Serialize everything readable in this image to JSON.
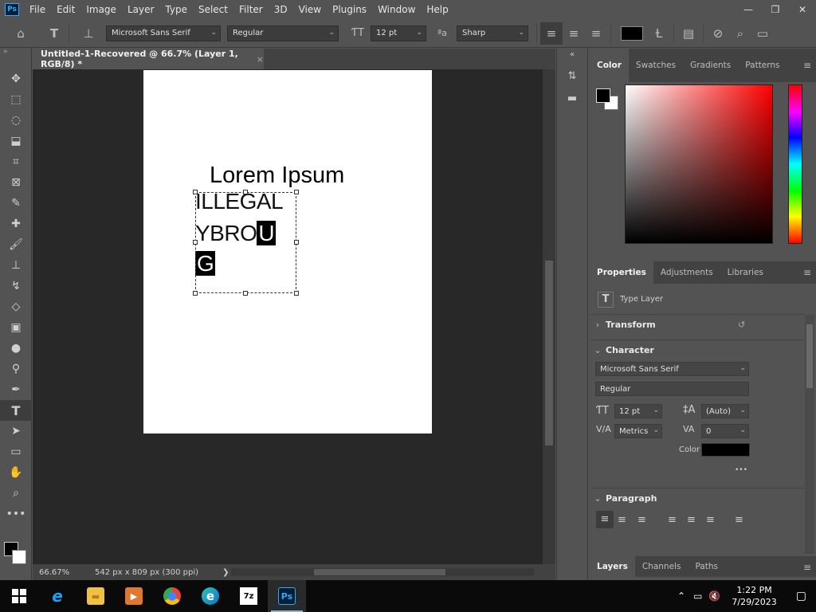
{
  "menu": {
    "logo": "Ps",
    "items": [
      "File",
      "Edit",
      "Image",
      "Layer",
      "Type",
      "Select",
      "Filter",
      "3D",
      "View",
      "Plugins",
      "Window",
      "Help"
    ]
  },
  "window_controls": {
    "minimize": "—",
    "restore": "❐",
    "close": "✕"
  },
  "options": {
    "font_family": "Microsoft Sans Serif",
    "font_style": "Regular",
    "font_size": "12 pt",
    "aa_label": "ªa",
    "antialias": "Sharp",
    "text_color": "#000000"
  },
  "document": {
    "tab_title": "Untitled-1-Recovered @ 66.7% (Layer 1, RGB/8) *",
    "tab_close": "×",
    "title_text": "Lorem Ipsum",
    "line1": "ILLEGAL",
    "line2_plain": "YBRO",
    "line2_selected": "U",
    "line3_selected": "G"
  },
  "status": {
    "zoom": "66.67%",
    "doc_info": "542 px x 809 px (300 ppi)",
    "arrow": "❯"
  },
  "color_panel": {
    "tabs": [
      "Color",
      "Swatches",
      "Gradients",
      "Patterns"
    ],
    "foreground": "#000000",
    "background": "#ffffff",
    "hue": "#ff0000"
  },
  "properties_panel": {
    "tabs": [
      "Properties",
      "Adjustments",
      "Libraries"
    ],
    "layer_type": "Type Layer",
    "transform_label": "Transform",
    "character_label": "Character",
    "font_family": "Microsoft Sans Serif",
    "font_style": "Regular",
    "font_size": "12 pt",
    "leading": "(Auto)",
    "kerning": "Metrics",
    "tracking": "0",
    "color_label": "Color",
    "color_value": "#000000",
    "more": "•••",
    "paragraph_label": "Paragraph"
  },
  "layers_panel": {
    "tabs": [
      "Layers",
      "Channels",
      "Paths"
    ]
  },
  "taskbar": {
    "apps": [
      {
        "name": "internet-explorer",
        "glyph": "e",
        "color": "#1ea1f1"
      },
      {
        "name": "file-explorer",
        "glyph": "▬",
        "color": "#f0c040"
      },
      {
        "name": "media-player",
        "glyph": "▶",
        "color": "#e07830"
      },
      {
        "name": "chrome",
        "glyph": "●",
        "color": "#4caf50"
      },
      {
        "name": "edge",
        "glyph": "e",
        "color": "#2ec4b6"
      },
      {
        "name": "7zip",
        "glyph": "7z",
        "color": "#ffffff"
      },
      {
        "name": "photoshop",
        "glyph": "Ps",
        "color": "#31a8ff"
      }
    ],
    "time": "1:22 PM",
    "date": "7/29/2023"
  }
}
